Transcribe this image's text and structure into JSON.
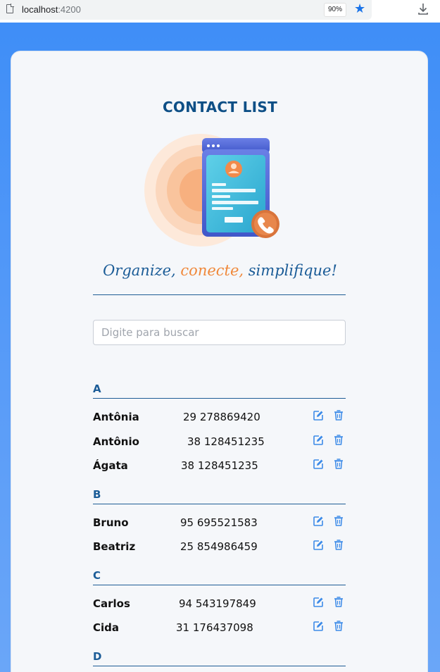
{
  "browser": {
    "url_host": "localhost",
    "url_port": ":4200",
    "zoom": "90%"
  },
  "app": {
    "title": "CONTACT LIST",
    "slogan": {
      "part1": "Organize,",
      "part2": "conecte,",
      "part3": "simplifique!"
    },
    "search_placeholder": "Digite para buscar"
  },
  "colors": {
    "accent": "#1b5c97",
    "highlight": "#f0883a",
    "background": "#3f8ef7",
    "icon": "#3d8be8"
  },
  "groups": [
    {
      "letter": "A",
      "contacts": [
        {
          "name": "Antônia",
          "phone": "29 278869420"
        },
        {
          "name": "Antônio",
          "phone": "38 128451235"
        },
        {
          "name": "Ágata",
          "phone": "38 128451235"
        }
      ]
    },
    {
      "letter": "B",
      "contacts": [
        {
          "name": "Bruno",
          "phone": "95 695521583"
        },
        {
          "name": "Beatriz",
          "phone": "25 854986459"
        }
      ]
    },
    {
      "letter": "C",
      "contacts": [
        {
          "name": "Carlos",
          "phone": "94 543197849"
        },
        {
          "name": "Cida",
          "phone": "31 176437098"
        }
      ]
    },
    {
      "letter": "D",
      "contacts": []
    }
  ],
  "icons": {
    "edit": "edit-icon",
    "delete": "trash-icon"
  }
}
